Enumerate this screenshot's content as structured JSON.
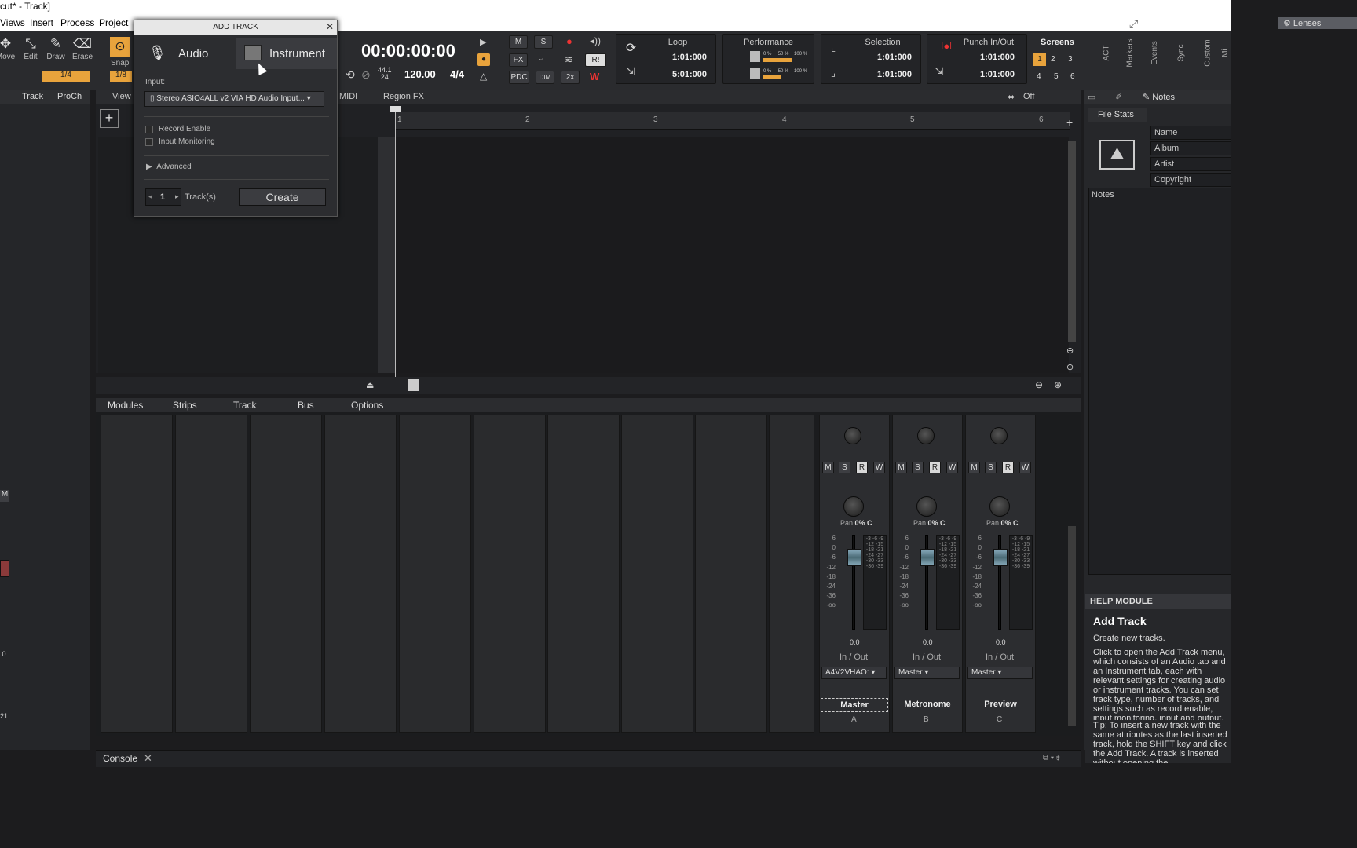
{
  "window": {
    "title": "cut* - Track]"
  },
  "menu": [
    "Views",
    "Insert",
    "Process",
    "Project"
  ],
  "lenses": "Lenses",
  "tools": [
    {
      "label": "Move",
      "icon": "move-icon"
    },
    {
      "label": "Edit",
      "icon": "edit-icon"
    },
    {
      "label": "Draw",
      "icon": "pencil-icon"
    },
    {
      "label": "Erase",
      "icon": "eraser-icon"
    }
  ],
  "snap": {
    "label": "Snap",
    "value": "1/4",
    "value2": "1/8"
  },
  "transport": {
    "time": "00:00:00:00",
    "sample_rate": "44.1",
    "bit_depth": "24",
    "tempo": "120.00",
    "meter": "4/4",
    "mixer_buttons": {
      "m": "M",
      "s": "S",
      "fx": "FX",
      "pdc": "PDC",
      "dim": "DIM",
      "x2": "2x",
      "ri": "R!"
    }
  },
  "loop": {
    "title": "Loop",
    "start": "1:01:000",
    "end": "5:01:000"
  },
  "performance": {
    "title": "Performance",
    "row1_a": "0 %",
    "row1_b": "50 %",
    "row1_c": "100 %",
    "row2_a": "0 %",
    "row2_b": "50 %",
    "row2_c": "100 %"
  },
  "selection": {
    "title": "Selection",
    "start": "1:01:000",
    "end": "1:01:000"
  },
  "punch": {
    "title": "Punch In/Out",
    "start": "1:01:000",
    "end": "1:01:000"
  },
  "screensets": {
    "title": "Screens",
    "nums": [
      "1",
      "2",
      "3",
      "4",
      "5",
      "6"
    ]
  },
  "vtabs": [
    "ACT",
    "Markers",
    "Events",
    "Sync",
    "Custom",
    "Mi"
  ],
  "left": {
    "tab_track": "Track",
    "tab_proch": "ProCh",
    "m": "M",
    "val1": ".0",
    "val2": "21"
  },
  "track_view": {
    "view": "View",
    "midi": "MIDI",
    "regionfx": "Region FX",
    "off": "Off",
    "ruler": [
      "1",
      "2",
      "3",
      "4",
      "5",
      "6"
    ]
  },
  "dialog": {
    "title": "ADD TRACK",
    "tab_audio": "Audio",
    "tab_instrument": "Instrument",
    "input_label": "Input:",
    "input_value": "Stereo ASIO4ALL v2 VIA HD Audio Input...",
    "record_enable": "Record Enable",
    "input_monitoring": "Input Monitoring",
    "advanced": "Advanced",
    "count": "1",
    "tracks": "Track(s)",
    "create": "Create"
  },
  "console_menu": [
    "Modules",
    "Strips",
    "Track",
    "Bus",
    "Options"
  ],
  "strips": [
    {
      "name": "Master",
      "letter": "A",
      "pan": "Pan",
      "panval": "0% C",
      "vol": "0.0",
      "io": "In / Out",
      "out": "A4V2VHAO:"
    },
    {
      "name": "Metronome",
      "letter": "B",
      "pan": "Pan",
      "panval": "0% C",
      "vol": "0.0",
      "io": "In / Out",
      "out": "Master"
    },
    {
      "name": "Preview",
      "letter": "C",
      "pan": "Pan",
      "panval": "0% C",
      "vol": "0.0",
      "io": "In / Out",
      "out": "Master"
    }
  ],
  "msrw": [
    "M",
    "S",
    "R",
    "W"
  ],
  "scale": [
    "6",
    "0",
    "-6",
    "-12",
    "-18",
    "-24",
    "-36",
    "-oo"
  ],
  "meter_scale": "-3 -6 -9 -12 -15 -18 -21 -24 -27 -30 -33 -36 -39",
  "browser": {
    "tab": "Notes",
    "file_stats": "File Stats",
    "fields": [
      "Name",
      "Album",
      "Artist",
      "Copyright"
    ],
    "notes": "Notes"
  },
  "help": {
    "header": "HELP MODULE",
    "title": "Add Track",
    "subtitle": "Create new tracks.",
    "p1": "Click to open the Add Track menu, which consists of an Audio tab and an Instrument tab, each with relevant settings for creating audio or instrument tracks. You can set track type, number of tracks, and settings such as record enable, input monitoring, input and output.",
    "p2": "Tip: To insert a new track with the same attributes as the last inserted track, hold the SHIFT key and click the Add Track. A track is inserted without opening the"
  },
  "status": {
    "console": "Console"
  }
}
